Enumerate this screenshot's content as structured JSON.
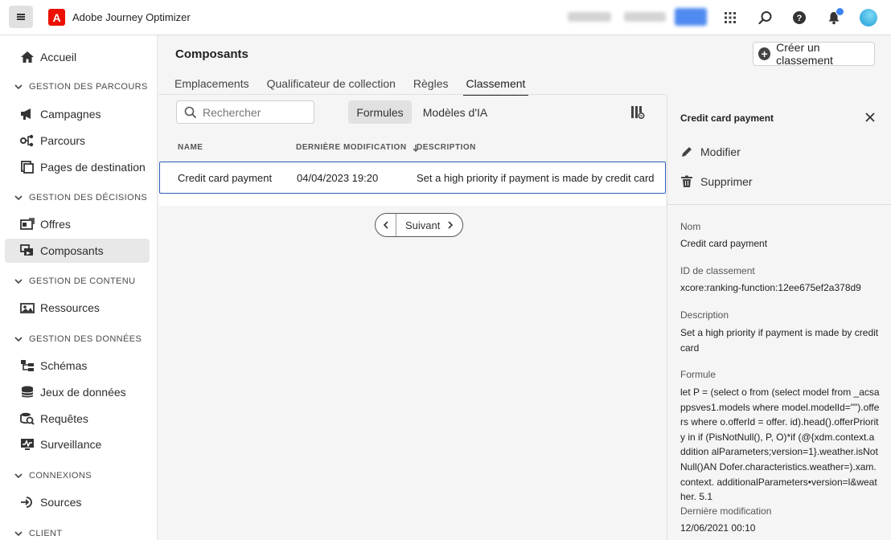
{
  "app": {
    "title": "Adobe Journey Optimizer",
    "logo_letter": "A",
    "accent": "#eb1000"
  },
  "topbar": {
    "icons": [
      "apps-grid-icon",
      "search-icon",
      "help-icon",
      "bell-icon",
      "avatar"
    ]
  },
  "sidebar": {
    "home": "Accueil",
    "sections": {
      "parcours": "GESTION DES PARCOURS",
      "decisions": "GESTION DES DÉCISIONS",
      "contenu": "GESTION DE CONTENU",
      "donnees": "GESTION DES DONNÉES",
      "connexions": "CONNEXIONS",
      "client": "CLIENT"
    },
    "items": {
      "campagnes": "Campagnes",
      "parcours": "Parcours",
      "pages": "Pages de destination",
      "offres": "Offres",
      "composants": "Composants",
      "ressources": "Ressources",
      "schemas": "Schémas",
      "jeux": "Jeux de données",
      "requetes": "Requêtes",
      "surveillance": "Surveillance",
      "sources": "Sources"
    }
  },
  "main": {
    "title": "Composants",
    "create_label": "Créer un classement",
    "tabs": [
      "Emplacements",
      "Qualificateur de collection",
      "Règles",
      "Classement"
    ],
    "active_tab": "Classement",
    "search_placeholder": "Rechercher",
    "toggle": {
      "formulas": "Formules",
      "ai_models": "Modèles d'IA"
    },
    "table": {
      "headers": {
        "name": "NAME",
        "modified": "DERNIÈRE MODIFICATION",
        "description": "DESCRIPTION"
      },
      "rows": [
        {
          "name": "Credit card payment",
          "modified": "04/04/2023 19:20",
          "description": "Set a high priority if payment is made by credit card"
        }
      ]
    },
    "pager": {
      "next": "Suivant"
    }
  },
  "panel": {
    "title": "Credit card payment",
    "actions": {
      "edit": "Modifier",
      "delete": "Supprimer"
    },
    "fields": {
      "name_label": "Nom",
      "name_value": "Credit card payment",
      "id_label": "ID de classement",
      "id_value": "xcore:ranking-function:12ee675ef2a378d9",
      "desc_label": "Description",
      "desc_value": "Set a high priority if payment is made by credit card",
      "formula_label": "Formule",
      "formula_value": "let P = (select o from (select model from _acsappsves1.models where model.modelId=\"\").offers where o.offerId = offer. id).head().offerPriority in if (PisNotNull(), P, O)*if (@{xdm.context.addition alParameters;version=1}.weather.isNotNull()AN Dofer.characteristics.weather=).xam.context. additionalParameters•version=l&weather. 5.1",
      "modified_label": "Dernière modification",
      "modified_value": "12/06/2021 00:10"
    }
  }
}
